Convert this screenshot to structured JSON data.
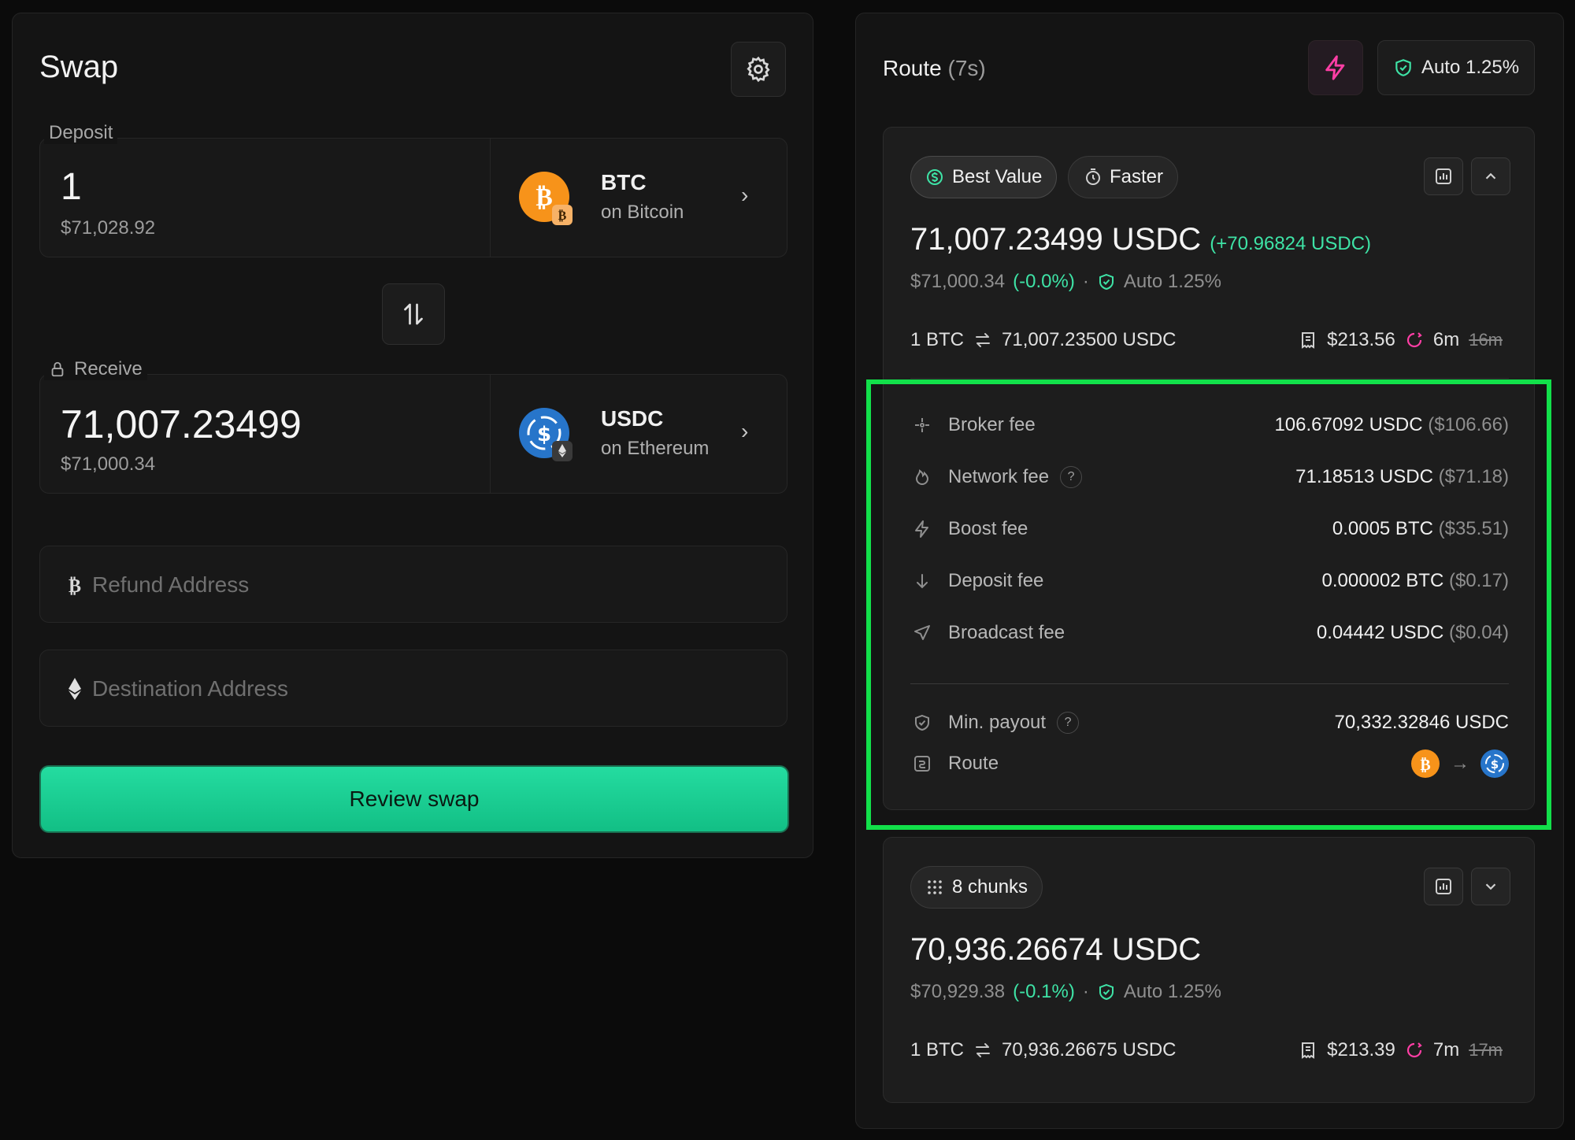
{
  "swap": {
    "title": "Swap",
    "deposit": {
      "label": "Deposit",
      "amount": "1",
      "usd": "$71,028.92",
      "token": "BTC",
      "chain": "on Bitcoin"
    },
    "receive": {
      "label": "Receive",
      "amount": "71,007.23499",
      "usd": "$71,000.34",
      "token": "USDC",
      "chain": "on Ethereum"
    },
    "refund_placeholder": "Refund Address",
    "destination_placeholder": "Destination Address",
    "review_label": "Review swap"
  },
  "route": {
    "title": "Route",
    "timer": "(7s)",
    "slippage": "Auto 1.25%",
    "best": {
      "pill_best": "Best Value",
      "pill_faster": "Faster",
      "amount": "71,007.23499 USDC",
      "diff": "(+70.96824 USDC)",
      "usd": "$71,000.34",
      "pct": "(-0.0%)",
      "dot": "·",
      "slip": "Auto 1.25%",
      "rate_from": "1 BTC",
      "rate_to": "71,007.23500 USDC",
      "fee_total": "$213.56",
      "time": "6m",
      "time_old": "16m",
      "fees": [
        {
          "label": "Broker fee",
          "value": "106.67092 USDC",
          "usd": "($106.66)",
          "icon": "broker-icon"
        },
        {
          "label": "Network fee",
          "value": "71.18513 USDC",
          "usd": "($71.18)",
          "icon": "flame-icon",
          "help": "?"
        },
        {
          "label": "Boost fee",
          "value": "0.0005 BTC",
          "usd": "($35.51)",
          "icon": "bolt-icon"
        },
        {
          "label": "Deposit fee",
          "value": "0.000002 BTC",
          "usd": "($0.17)",
          "icon": "arrow-down-icon"
        },
        {
          "label": "Broadcast fee",
          "value": "0.04442 USDC",
          "usd": "($0.04)",
          "icon": "send-icon"
        }
      ],
      "min_payout_label": "Min. payout",
      "min_payout_help": "?",
      "min_payout_value": "70,332.32846 USDC",
      "route_label": "Route",
      "route_arrow": "→"
    },
    "chunks": {
      "pill": "8 chunks",
      "amount": "70,936.26674 USDC",
      "usd": "$70,929.38",
      "pct": "(-0.1%)",
      "dot": "·",
      "slip": "Auto 1.25%",
      "rate_from": "1 BTC",
      "rate_to": "70,936.26675 USDC",
      "fee_total": "$213.39",
      "time": "7m",
      "time_old": "17m"
    }
  },
  "colors": {
    "accent_green": "#3ee3a6",
    "button_green": "#1ccf92",
    "btc_orange": "#f7931a",
    "usdc_blue": "#2775ca",
    "boost_pink": "#ff3ea5",
    "highlight": "#12e04a"
  }
}
